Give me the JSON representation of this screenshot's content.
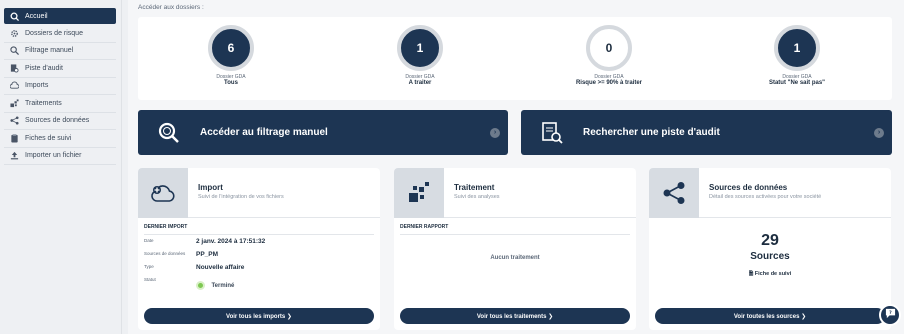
{
  "sidebar": {
    "items": [
      {
        "label": "Accueil",
        "icon": "search-circle-icon",
        "active": true
      },
      {
        "label": "Dossiers de risque",
        "icon": "gear-cluster-icon"
      },
      {
        "label": "Filtrage manuel",
        "icon": "magnifier-icon"
      },
      {
        "label": "Piste d'audit",
        "icon": "document-search-icon"
      },
      {
        "label": "Imports",
        "icon": "cloud-upload-icon"
      },
      {
        "label": "Traitements",
        "icon": "blocks-icon"
      },
      {
        "label": "Sources de données",
        "icon": "share-nodes-icon"
      },
      {
        "label": "Fiches de suivi",
        "icon": "clipboard-icon"
      },
      {
        "label": "Importer un fichier",
        "icon": "upload-icon"
      }
    ]
  },
  "main": {
    "access_label": "Accéder aux dossiers :",
    "stats": [
      {
        "value": "6",
        "sub": "Dossier GDA",
        "label": "Tous"
      },
      {
        "value": "1",
        "sub": "Dossier GDA",
        "label": "A traiter"
      },
      {
        "value": "0",
        "sub": "Dossier GDA",
        "label": "Risque >= 90% à traiter"
      },
      {
        "value": "1",
        "sub": "Dossier GDA",
        "label": "Statut \"Ne sait pas\""
      }
    ],
    "actions": {
      "filter_label": "Accéder au filtrage manuel",
      "audit_label": "Rechercher une piste d'audit"
    },
    "import_card": {
      "title": "Import",
      "desc": "Suivi de l'intégration de vos fichiers",
      "section": "DERNIER IMPORT",
      "rows": [
        {
          "key": "Date",
          "value": "2 janv. 2024 à 17:51:32"
        },
        {
          "key": "Sources de données",
          "value": "PP_PM"
        },
        {
          "key": "Type",
          "value": "Nouvelle affaire"
        }
      ],
      "status_key": "Statut",
      "status_value": "Terminé",
      "button": "Voir tous les imports ❯"
    },
    "treatment_card": {
      "title": "Traitement",
      "desc": "Suivi des analyses",
      "section": "DERNIER RAPPORT",
      "empty": "Aucun traitement",
      "button": "Voir tous les traitements ❯"
    },
    "sources_card": {
      "title": "Sources de données",
      "desc": "Détail des sources activées pour votre société",
      "count": "29",
      "count_label": "Sources",
      "link": "Fiche de suivi",
      "button": "Voir toutes les sources ❯"
    }
  },
  "colors": {
    "primary": "#1d3553",
    "status_ok": "#7ec852"
  }
}
